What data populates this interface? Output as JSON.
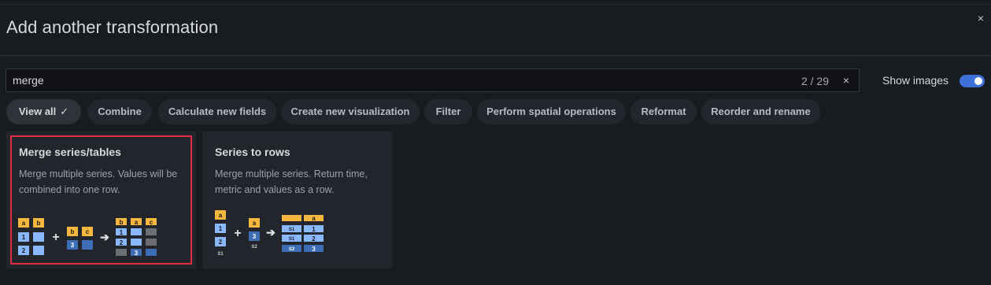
{
  "dialog": {
    "title": "Add another transformation",
    "close_icon": "×"
  },
  "search": {
    "value": "merge",
    "result_count": "2 / 29",
    "clear_icon": "×"
  },
  "show_images": {
    "label": "Show images",
    "enabled": true,
    "accent_color": "#3d71d9"
  },
  "filters": [
    {
      "label": "View all",
      "active": true,
      "check_icon": "✓"
    },
    {
      "label": "Combine"
    },
    {
      "label": "Calculate new fields"
    },
    {
      "label": "Create new visualization"
    },
    {
      "label": "Filter"
    },
    {
      "label": "Perform spatial operations"
    },
    {
      "label": "Reformat"
    },
    {
      "label": "Reorder and rename"
    }
  ],
  "cards": [
    {
      "title": "Merge series/tables",
      "description": "Merge multiple series. Values will be combined into one row.",
      "highlighted": true,
      "illustration": {
        "table1": {
          "headers": [
            "a",
            "b"
          ],
          "rows": [
            "1",
            "2"
          ]
        },
        "table2": {
          "headers": [
            "b",
            "c"
          ],
          "rows": [
            "3"
          ]
        },
        "result": {
          "headers": [
            "b",
            "a",
            "c"
          ],
          "rows": [
            "1",
            "2",
            "3"
          ]
        }
      }
    },
    {
      "title": "Series to rows",
      "description": "Merge multiple series. Return time, metric and values as a row.",
      "highlighted": false,
      "illustration": {
        "table1": {
          "header": "a",
          "rows": [
            "1",
            "2"
          ],
          "caption": "S1"
        },
        "table2": {
          "header": "a",
          "rows": [
            "3"
          ],
          "caption": "S2"
        },
        "result": {
          "header": "a",
          "series_col": [
            "S1",
            "S1",
            "S2"
          ],
          "values": [
            "1",
            "2",
            "3"
          ]
        }
      }
    }
  ],
  "colors": {
    "header_yellow": "#f5b73d",
    "cell_blue_light": "#8ab8ff",
    "cell_blue_dark": "#3d6db5",
    "cell_gray": "#6e6f73",
    "outline_red": "#e02f44"
  }
}
